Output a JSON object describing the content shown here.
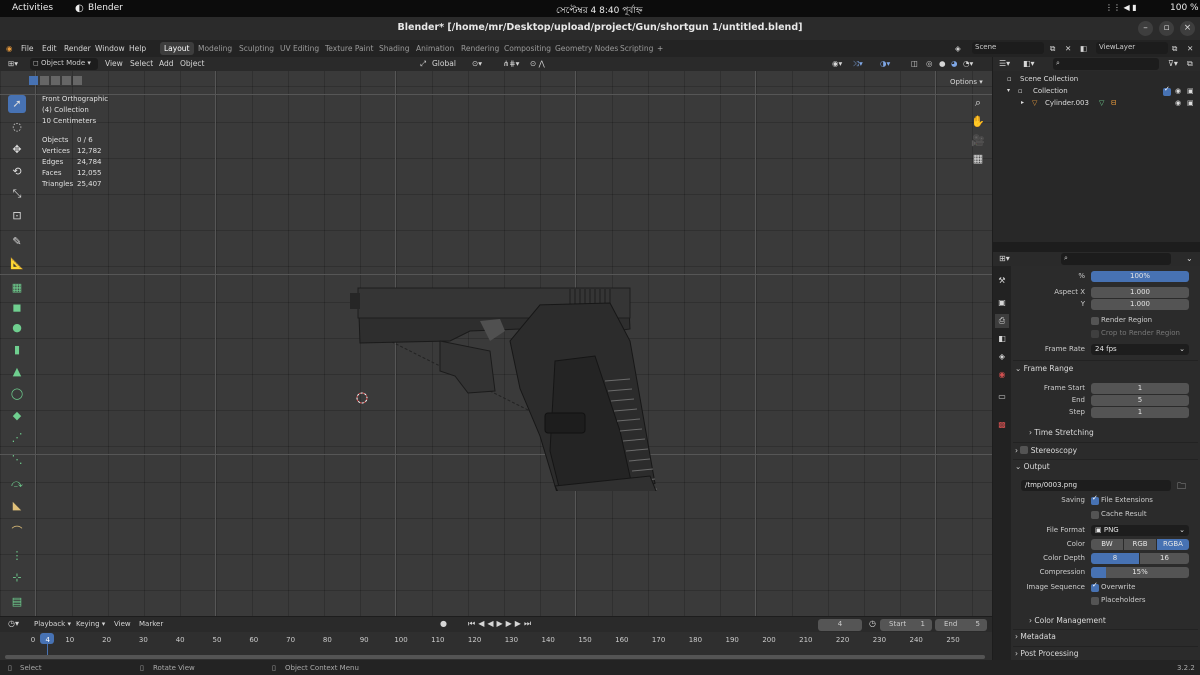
{
  "gnome": {
    "activities": "Activities",
    "app": "Blender",
    "clock": "সেপ্টেম্বর 4  8:40 পূর্বাহ্ন",
    "battery": "100 %"
  },
  "window": {
    "title": "Blender* [/home/mr/Desktop/upload/project/Gun/shortgun 1/untitled.blend]"
  },
  "menu": {
    "items": [
      "File",
      "Edit",
      "Render",
      "Window",
      "Help"
    ],
    "workspaces": [
      "Layout",
      "Modeling",
      "Sculpting",
      "UV Editing",
      "Texture Paint",
      "Shading",
      "Animation",
      "Rendering",
      "Compositing",
      "Geometry Nodes",
      "Scripting"
    ],
    "add": "+",
    "scene": "Scene",
    "view_layer": "ViewLayer"
  },
  "viewport_header": {
    "mode": "Object Mode",
    "view": "View",
    "select": "Select",
    "add": "Add",
    "object": "Object",
    "orientation": "Global",
    "options": "Options"
  },
  "overlay": {
    "view": "Front Orthographic",
    "collection": "(4) Collection",
    "scale": "10 Centimeters",
    "stats": [
      {
        "k": "Objects",
        "v": "0 / 6"
      },
      {
        "k": "Vertices",
        "v": "12,782"
      },
      {
        "k": "Edges",
        "v": "24,784"
      },
      {
        "k": "Faces",
        "v": "12,055"
      },
      {
        "k": "Triangles",
        "v": "25,407"
      }
    ]
  },
  "outliner": {
    "scene_collection": "Scene Collection",
    "collection": "Collection",
    "object": "Cylinder.003"
  },
  "properties": {
    "percent_label": "%",
    "percent_value": "100%",
    "aspect_x_label": "Aspect X",
    "aspect_x": "1.000",
    "aspect_y_label": "Y",
    "aspect_y": "1.000",
    "render_region": "Render Region",
    "crop": "Crop to Render Region",
    "frame_rate_label": "Frame Rate",
    "frame_rate": "24 fps",
    "frame_range": "Frame Range",
    "frame_start_label": "Frame Start",
    "frame_start": "1",
    "end_label": "End",
    "end": "5",
    "step_label": "Step",
    "step": "1",
    "time_stretching": "Time Stretching",
    "stereoscopy": "Stereoscopy",
    "output": "Output",
    "output_path": "/tmp/0003.png",
    "saving_label": "Saving",
    "file_extensions": "File Extensions",
    "cache_result": "Cache Result",
    "file_format_label": "File Format",
    "file_format": "PNG",
    "color_label": "Color",
    "color_options": [
      "BW",
      "RGB",
      "RGBA"
    ],
    "color_depth_label": "Color Depth",
    "color_depth": [
      "8",
      "16"
    ],
    "compression_label": "Compression",
    "compression": "15%",
    "compression_level": 15,
    "image_sequence_label": "Image Sequence",
    "overwrite": "Overwrite",
    "placeholders": "Placeholders",
    "color_management": "Color Management",
    "metadata": "Metadata",
    "post_processing": "Post Processing"
  },
  "timeline": {
    "playback": "Playback",
    "keying": "Keying",
    "view": "View",
    "marker": "Marker",
    "current_frame": "4",
    "start_label": "Start",
    "start": "1",
    "end_label": "End",
    "end": "5",
    "ticks": [
      "0",
      "4",
      "10",
      "20",
      "30",
      "40",
      "50",
      "60",
      "70",
      "80",
      "90",
      "100",
      "110",
      "120",
      "130",
      "140",
      "150",
      "160",
      "170",
      "180",
      "190",
      "200",
      "210",
      "220",
      "230",
      "240",
      "250"
    ]
  },
  "status": {
    "select": "Select",
    "rotate": "Rotate View",
    "context": "Object Context Menu",
    "version": "3.2.2"
  },
  "colors": {
    "accent": "#4772b3",
    "selection_orange": "#e89a3c"
  }
}
